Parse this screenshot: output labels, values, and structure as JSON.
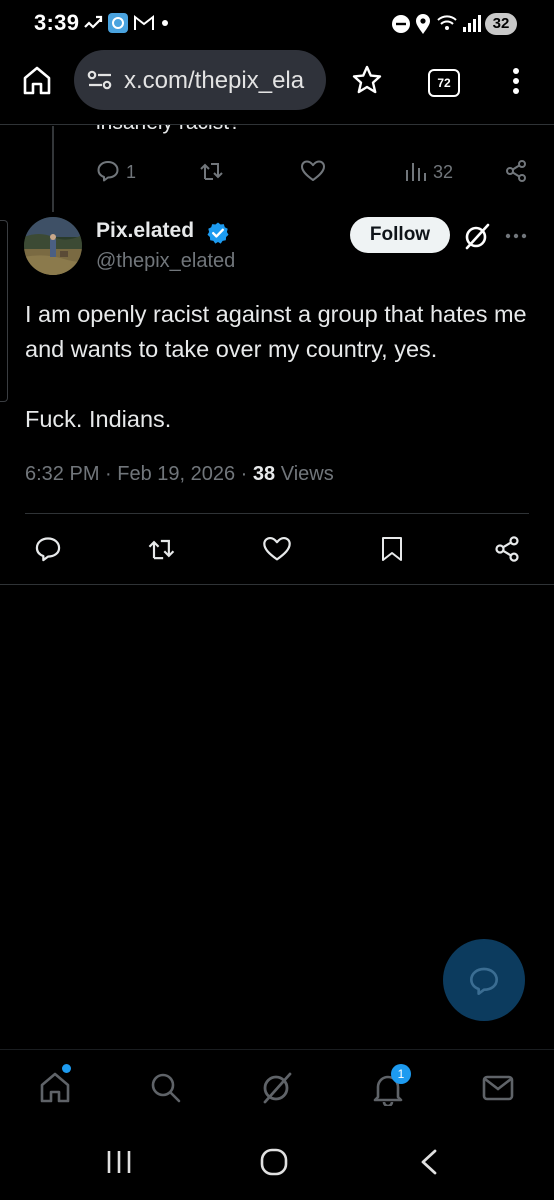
{
  "status_bar": {
    "time": "3:39",
    "battery": "32",
    "left_icons": [
      "missed-call-icon",
      "app-notification-icon",
      "gmail-icon",
      "dot-icon"
    ],
    "right_icons": [
      "do-not-disturb-icon",
      "location-icon",
      "wifi-icon",
      "signal-icon"
    ]
  },
  "browser": {
    "url": "x.com/thepix_ela",
    "tab_count": "72",
    "icons": [
      "home-icon",
      "site-settings-icon",
      "bookmark-star-icon",
      "tabs-icon",
      "more-vertical-icon"
    ]
  },
  "previous_tweet": {
    "text_fragment": "insanely racist?",
    "replies": "1",
    "views": "32"
  },
  "tweet": {
    "display_name": "Pix.elated",
    "handle": "@thepix_elated",
    "follow_label": "Follow",
    "text": "I am openly racist against a group that hates me and wants to take over my country, yes.\n\nFuck. Indians.",
    "timestamp": "6:32 PM · Feb 19, 2026 · ",
    "views_count": "38",
    "views_label": " Views"
  },
  "bottom_nav": {
    "items": [
      "home-icon",
      "search-icon",
      "grok-icon",
      "notifications-icon",
      "messages-icon"
    ],
    "notification_count": "1"
  },
  "colors": {
    "background": "#000000",
    "text": "#e7e9ea",
    "muted": "#71767b",
    "accent": "#1d9bf0",
    "fab": "#0c3b5e"
  }
}
